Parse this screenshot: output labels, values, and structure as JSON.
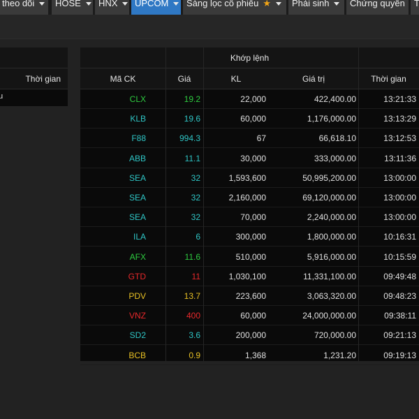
{
  "nav": {
    "tabs": [
      {
        "label": "theo dõi",
        "active": false,
        "star": false
      },
      {
        "label": "HOSE",
        "active": false,
        "star": false
      },
      {
        "label": "HNX",
        "active": false,
        "star": false
      },
      {
        "label": "UPCOM",
        "active": true,
        "star": false
      },
      {
        "label": "Sàng lọc cổ phiếu",
        "active": false,
        "star": true
      },
      {
        "label": "Phái sinh",
        "active": false,
        "star": false
      },
      {
        "label": "Chứng quyền",
        "active": false,
        "star": false
      },
      {
        "label": "T",
        "active": false,
        "star": false
      }
    ]
  },
  "left_panel": {
    "col_time": "Thời gian",
    "first_row_text": "u"
  },
  "match_panel": {
    "title": "Khớp lệnh",
    "headers": {
      "symbol": "Mã CK",
      "price": "Giá",
      "volume": "KL",
      "value": "Giá trị",
      "time": "Thời gian"
    },
    "rows": [
      {
        "symbol": "CLX",
        "price": "19.2",
        "volume": "22,000",
        "value": "422,400.00",
        "time": "13:21:33",
        "color": "#2ecc40"
      },
      {
        "symbol": "KLB",
        "price": "19.6",
        "volume": "60,000",
        "value": "1,176,000.00",
        "time": "13:13:29",
        "color": "#2fc6c6"
      },
      {
        "symbol": "F88",
        "price": "994.3",
        "volume": "67",
        "value": "66,618.10",
        "time": "13:12:53",
        "color": "#2fc6c6"
      },
      {
        "symbol": "ABB",
        "price": "11.1",
        "volume": "30,000",
        "value": "333,000.00",
        "time": "13:11:36",
        "color": "#2fc6c6"
      },
      {
        "symbol": "SEA",
        "price": "32",
        "volume": "1,593,600",
        "value": "50,995,200.00",
        "time": "13:00:00",
        "color": "#2fc6c6"
      },
      {
        "symbol": "SEA",
        "price": "32",
        "volume": "2,160,000",
        "value": "69,120,000.00",
        "time": "13:00:00",
        "color": "#2fc6c6"
      },
      {
        "symbol": "SEA",
        "price": "32",
        "volume": "70,000",
        "value": "2,240,000.00",
        "time": "13:00:00",
        "color": "#2fc6c6"
      },
      {
        "symbol": "ILA",
        "price": "6",
        "volume": "300,000",
        "value": "1,800,000.00",
        "time": "10:16:31",
        "color": "#2fc6c6"
      },
      {
        "symbol": "AFX",
        "price": "11.6",
        "volume": "510,000",
        "value": "5,916,000.00",
        "time": "10:15:59",
        "color": "#2ecc40"
      },
      {
        "symbol": "GTD",
        "price": "11",
        "volume": "1,030,100",
        "value": "11,331,100.00",
        "time": "09:49:48",
        "color": "#e8282b"
      },
      {
        "symbol": "PDV",
        "price": "13.7",
        "volume": "223,600",
        "value": "3,063,320.00",
        "time": "09:48:23",
        "color": "#e8c024"
      },
      {
        "symbol": "VNZ",
        "price": "400",
        "volume": "60,000",
        "value": "24,000,000.00",
        "time": "09:38:11",
        "color": "#e8282b"
      },
      {
        "symbol": "SD2",
        "price": "3.6",
        "volume": "200,000",
        "value": "720,000.00",
        "time": "09:21:13",
        "color": "#2fc6c6"
      },
      {
        "symbol": "BCB",
        "price": "0.9",
        "volume": "1,368",
        "value": "1,231.20",
        "time": "09:19:13",
        "color": "#e8c024"
      }
    ]
  },
  "colors": {
    "background": "#222222",
    "panel": "#0a0a0a",
    "active_tab": "#2f78c4",
    "neutral_text": "#e0e0e0"
  }
}
